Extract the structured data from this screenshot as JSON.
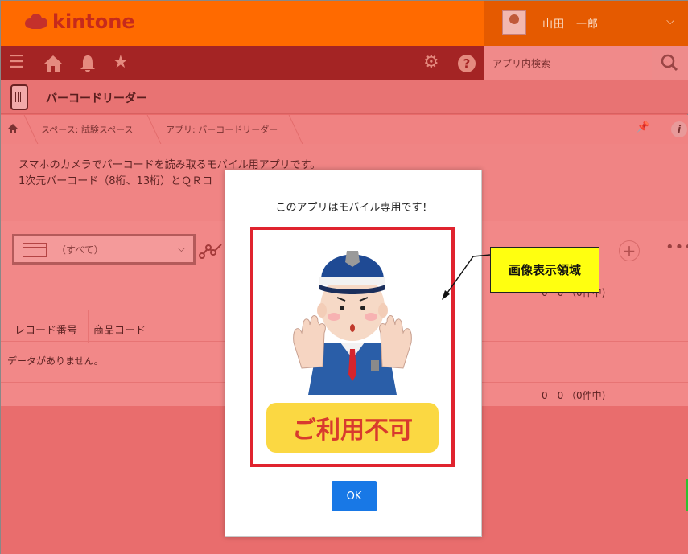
{
  "header": {
    "logo_text": "kintone",
    "user_name": "山田　一郎"
  },
  "search": {
    "placeholder": "アプリ内検索"
  },
  "app": {
    "title": "バーコードリーダー"
  },
  "breadcrumb": {
    "space": "スペース: 試験スペース",
    "app": "アプリ: バーコードリーダー"
  },
  "description": {
    "line1": "スマホのカメラでバーコードを読み取るモバイル用アプリです。",
    "line2": "1次元バーコード（8桁、13桁）とＱＲコ"
  },
  "view": {
    "selected": "（すべて）"
  },
  "records": {
    "count_text": "0 - 0 （0件中)",
    "columns": [
      "レコード番号",
      "商品コード"
    ],
    "empty_text": "データがありません。"
  },
  "modal": {
    "message": "このアプリはモバイル専用です！",
    "image_label": "ご利用不可",
    "ok_label": "OK"
  },
  "callout": {
    "text": "画像表示領域"
  },
  "colors": {
    "topbar": "#ff6a00",
    "navbar": "#a42424",
    "frame": "#e0232e",
    "ok_button": "#1878e6",
    "callout": "#ffff10"
  }
}
